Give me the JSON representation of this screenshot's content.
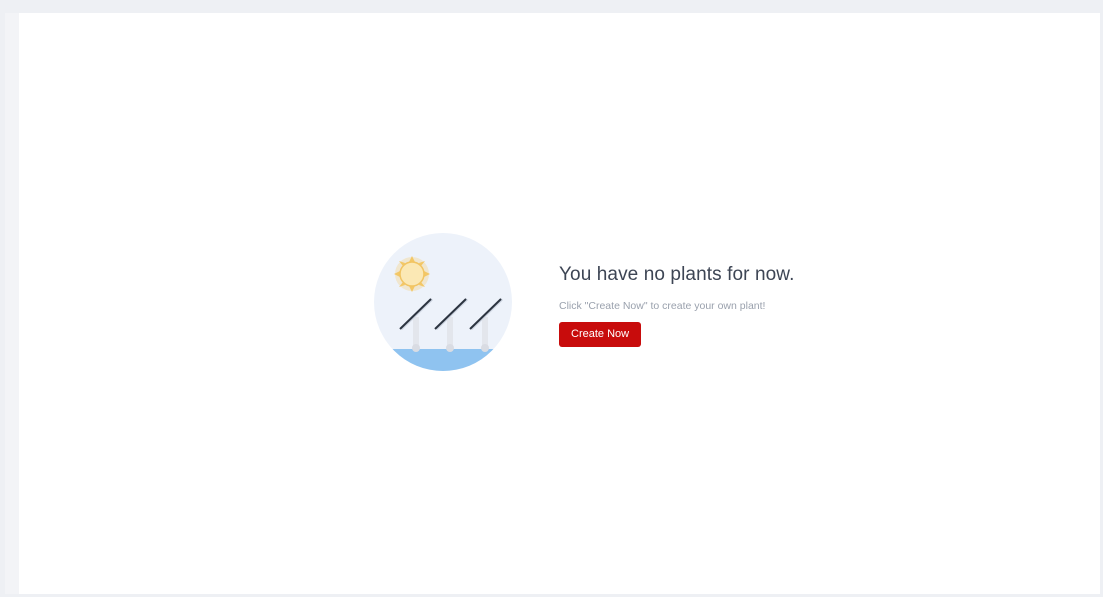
{
  "empty_state": {
    "title": "You have no plants for now.",
    "subtitle": "Click \"Create Now\" to create your own plant!",
    "create_button_label": "Create Now"
  },
  "illustration": {
    "icon": "solar-panels-sun-illustration",
    "colors": {
      "circle": "#edf2fa",
      "water": "#8fc3f0",
      "sun": "#fbe2a6",
      "panel": "#2c3440"
    }
  },
  "theme": {
    "accent": "#c80c0c"
  }
}
